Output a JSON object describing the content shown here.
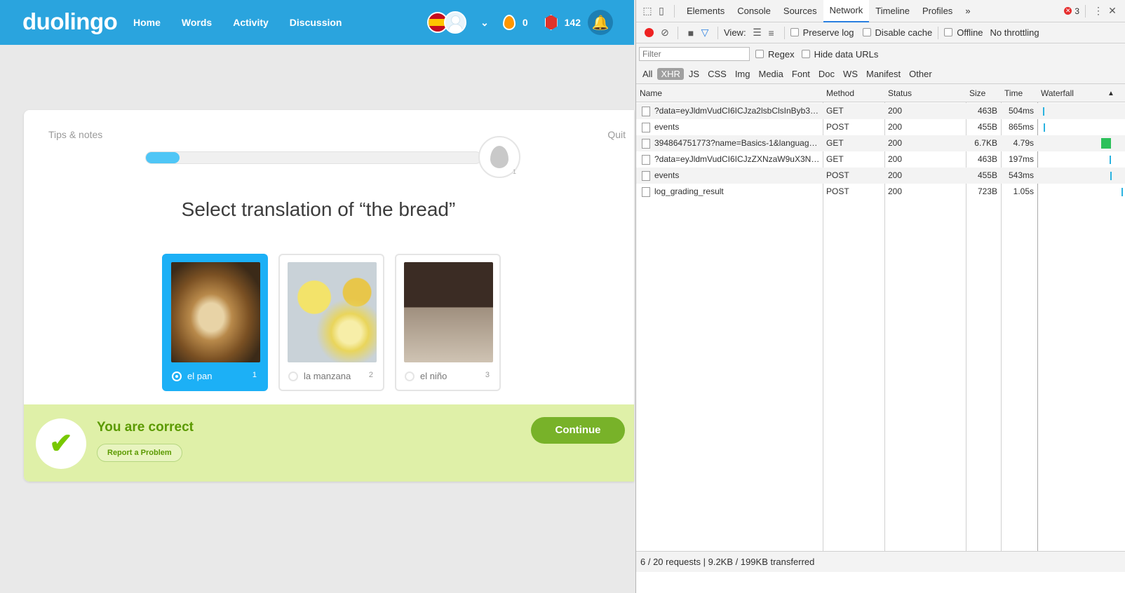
{
  "app": {
    "logo": "duolingo",
    "nav": [
      "Home",
      "Words",
      "Activity",
      "Discussion"
    ],
    "streak_count": "0",
    "lingots_count": "142"
  },
  "lesson": {
    "tips_label": "Tips & notes",
    "quit_label": "Quit",
    "progress_fraction": 0.1,
    "egg_count": "1",
    "prompt": "Select translation of “the bread”",
    "choices": [
      {
        "label": "el pan",
        "number": "1",
        "image": "bread-photo",
        "selected": true
      },
      {
        "label": "la manzana",
        "number": "2",
        "image": "apple-photo",
        "selected": false
      },
      {
        "label": "el niño",
        "number": "3",
        "image": "child-photo",
        "selected": false
      }
    ],
    "feedback_title": "You are correct",
    "report_label": "Report a Problem",
    "continue_label": "Continue"
  },
  "devtools": {
    "tabs": [
      "Elements",
      "Console",
      "Sources",
      "Network",
      "Timeline",
      "Profiles"
    ],
    "active_tab": "Network",
    "more_tabs": "»",
    "error_count": "3",
    "view_label": "View:",
    "preserve_log": "Preserve log",
    "disable_cache": "Disable cache",
    "offline": "Offline",
    "throttling": "No throttling",
    "filter_placeholder": "Filter",
    "regex": "Regex",
    "hide_data_urls": "Hide data URLs",
    "types": [
      "All",
      "XHR",
      "JS",
      "CSS",
      "Img",
      "Media",
      "Font",
      "Doc",
      "WS",
      "Manifest",
      "Other"
    ],
    "active_type": "XHR",
    "columns": [
      "Name",
      "Method",
      "Status",
      "Size",
      "Time",
      "Waterfall"
    ],
    "sort_indicator": "▲",
    "requests": [
      {
        "name": "?data=eyJldmVudCI6ICJza2lsbClsInByb3…",
        "method": "GET",
        "status": "200",
        "size": "463B",
        "time": "504ms",
        "wf_start": 0.03,
        "wf_width": 0.01,
        "wf_color": "#2bb3e0"
      },
      {
        "name": "events",
        "method": "POST",
        "status": "200",
        "size": "455B",
        "time": "865ms",
        "wf_start": 0.04,
        "wf_width": 0.01,
        "wf_color": "#2bb3e0"
      },
      {
        "name": "394864751773?name=Basics-1&languag…",
        "method": "GET",
        "status": "200",
        "size": "6.7KB",
        "time": "4.79s",
        "wf_start": 0.74,
        "wf_width": 0.12,
        "wf_color": "#2cc05a"
      },
      {
        "name": "?data=eyJldmVudCI6ICJzZXNzaW9uX3N…",
        "method": "GET",
        "status": "200",
        "size": "463B",
        "time": "197ms",
        "wf_start": 0.84,
        "wf_width": 0.01,
        "wf_color": "#2bb3e0"
      },
      {
        "name": "events",
        "method": "POST",
        "status": "200",
        "size": "455B",
        "time": "543ms",
        "wf_start": 0.85,
        "wf_width": 0.01,
        "wf_color": "#2bb3e0"
      },
      {
        "name": "log_grading_result",
        "method": "POST",
        "status": "200",
        "size": "723B",
        "time": "1.05s",
        "wf_start": 0.98,
        "wf_width": 0.01,
        "wf_color": "#2bb3e0"
      }
    ],
    "summary": "6 / 20 requests | 9.2KB / 199KB transferred"
  }
}
